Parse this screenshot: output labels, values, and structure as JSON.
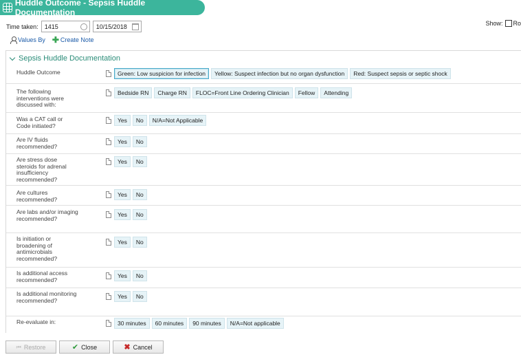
{
  "window": {
    "title": "Huddle Outcome - Sepsis Huddle Documentation",
    "title_icon": "grid-icon",
    "accent_color": "#3cb59c"
  },
  "toolbar": {
    "time_label": "Time taken:",
    "time_value": "1415",
    "date_value": "10/15/2018",
    "show_label": "Show:",
    "show_option": "Ro",
    "values_by": "Values By",
    "create_note": "Create Note"
  },
  "section": {
    "title": "Sepsis Huddle Documentation",
    "rows": [
      {
        "label": "Huddle Outcome",
        "options": [
          "Green: Low suspicion for infection",
          "Yellow: Suspect infection but no organ dysfunction",
          "Red: Suspect sepsis or septic shock"
        ],
        "selected": 0
      },
      {
        "label": "The following interventions were discussed with:",
        "options": [
          "Bedside RN",
          "Charge RN",
          "FLOC=Front Line Ordering Clinician",
          "Fellow",
          "Attending"
        ],
        "selected": -1
      },
      {
        "label": "Was a CAT call or Code initiated?",
        "options": [
          "Yes",
          "No",
          "N/A=Not Applicable"
        ],
        "selected": -1
      },
      {
        "label": "Are IV fluids recommended?",
        "options": [
          "Yes",
          "No"
        ],
        "selected": -1
      },
      {
        "label": "Are stress dose steroids for adrenal insufficiency recommended?",
        "options": [
          "Yes",
          "No"
        ],
        "selected": -1
      },
      {
        "label": "Are cultures recommended?",
        "options": [
          "Yes",
          "No"
        ],
        "selected": -1
      },
      {
        "label": "Are labs and/or imaging recommended?",
        "options": [
          "Yes",
          "No"
        ],
        "selected": -1
      },
      {
        "label": "Is initiation or broadening of antimicrobials recommended?",
        "options": [
          "Yes",
          "No"
        ],
        "selected": -1
      },
      {
        "label": "Is additional access recommended?",
        "options": [
          "Yes",
          "No"
        ],
        "selected": -1
      },
      {
        "label": "Is additional monitoring recommended?",
        "options": [
          "Yes",
          "No"
        ],
        "selected": -1
      },
      {
        "label": "Re-evaluate in:",
        "options": [
          "30 minutes",
          "60 minutes",
          "90 minutes",
          "N/A=Not applicable"
        ],
        "selected": -1
      }
    ]
  },
  "footer": {
    "restore": "Restore",
    "close": "Close",
    "cancel": "Cancel"
  }
}
